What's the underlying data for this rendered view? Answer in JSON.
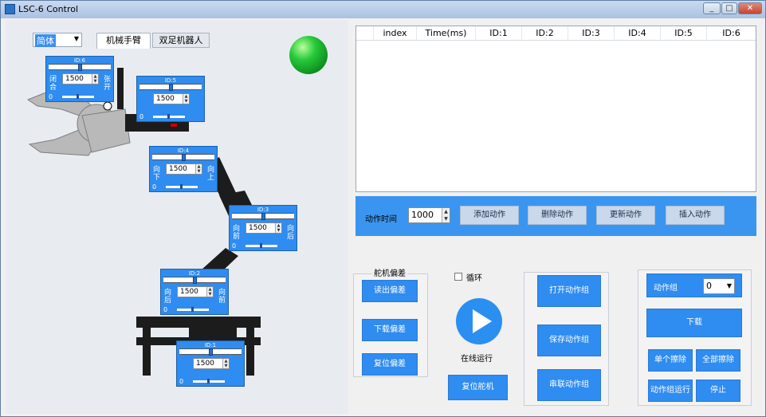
{
  "window": {
    "title": "LSC-6 Control"
  },
  "titlebar_buttons": {
    "minimize": "_",
    "maximize": "□",
    "close": "✕"
  },
  "font_select": {
    "value": "简体"
  },
  "tabs": [
    {
      "label": "机械手臂"
    },
    {
      "label": "双足机器人"
    }
  ],
  "servos": [
    {
      "id": "ID:6",
      "value": "1500",
      "left_label": "闭合",
      "right_label": "张开",
      "zero": "0",
      "position": 0.5
    },
    {
      "id": "ID:5",
      "value": "1500",
      "left_label": "",
      "right_label": "",
      "zero": "0",
      "position": 0.5
    },
    {
      "id": "ID:4",
      "value": "1500",
      "left_label": "向下",
      "right_label": "向上",
      "zero": "0",
      "position": 0.5
    },
    {
      "id": "ID:3",
      "value": "1500",
      "left_label": "向前",
      "right_label": "向后",
      "zero": "0",
      "position": 0.5
    },
    {
      "id": "ID:2",
      "value": "1500",
      "left_label": "向后",
      "right_label": "向前",
      "zero": "0",
      "position": 0.5
    },
    {
      "id": "ID:1",
      "value": "1500",
      "left_label": "",
      "right_label": "",
      "zero": "0",
      "position": 0.5
    }
  ],
  "table": {
    "columns": [
      "index",
      "Time(ms)",
      "ID:1",
      "ID:2",
      "ID:3",
      "ID:4",
      "ID:5",
      "ID:6"
    ],
    "rows": []
  },
  "action_bar": {
    "time_label": "动作时间",
    "time_value": "1000",
    "add": "添加动作",
    "delete": "删除动作",
    "update": "更新动作",
    "insert": "插入动作"
  },
  "offset_group": {
    "title": "舵机偏差",
    "read": "读出偏差",
    "download": "下载偏差",
    "reset": "复位偏差"
  },
  "run_group": {
    "loop_label": "循环",
    "online_run": "在线运行",
    "reset_servo": "复位舵机"
  },
  "file_group": {
    "open": "打开动作组",
    "save": "保存动作组",
    "chain": "串联动作组"
  },
  "download_group": {
    "group_label": "动作组",
    "group_value": "0",
    "download": "下载",
    "erase_single": "单个擦除",
    "erase_all": "全部擦除",
    "run_group": "动作组运行",
    "stop": "停止"
  },
  "colors": {
    "accent": "#2f8cf0",
    "band": "#3a95f0",
    "led": "#27c93a"
  }
}
